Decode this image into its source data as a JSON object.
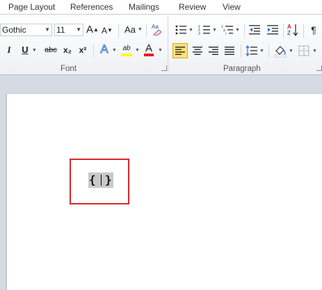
{
  "tabs": [
    "Page Layout",
    "References",
    "Mailings",
    "Review",
    "View"
  ],
  "font": {
    "name": "Gothic",
    "size": "11",
    "grow_label": "A",
    "shrink_label": "A",
    "case_label": "Aa",
    "italic_label": "I",
    "underline_label": "U",
    "strike_label": "abc",
    "subscript_label": "x₂",
    "superscript_label": "x²",
    "effects_label": "A",
    "highlight_label": "ab",
    "color_label": "A",
    "group_label": "Font"
  },
  "paragraph": {
    "group_label": "Paragraph",
    "pilcrow": "¶"
  },
  "colors": {
    "accent_red": "#d9272d",
    "highlight_yellow": "#ffff00",
    "font_color_red": "#e02020",
    "active_yellow": "#fde07a"
  },
  "document": {
    "field_open": "{",
    "field_close": "}"
  }
}
